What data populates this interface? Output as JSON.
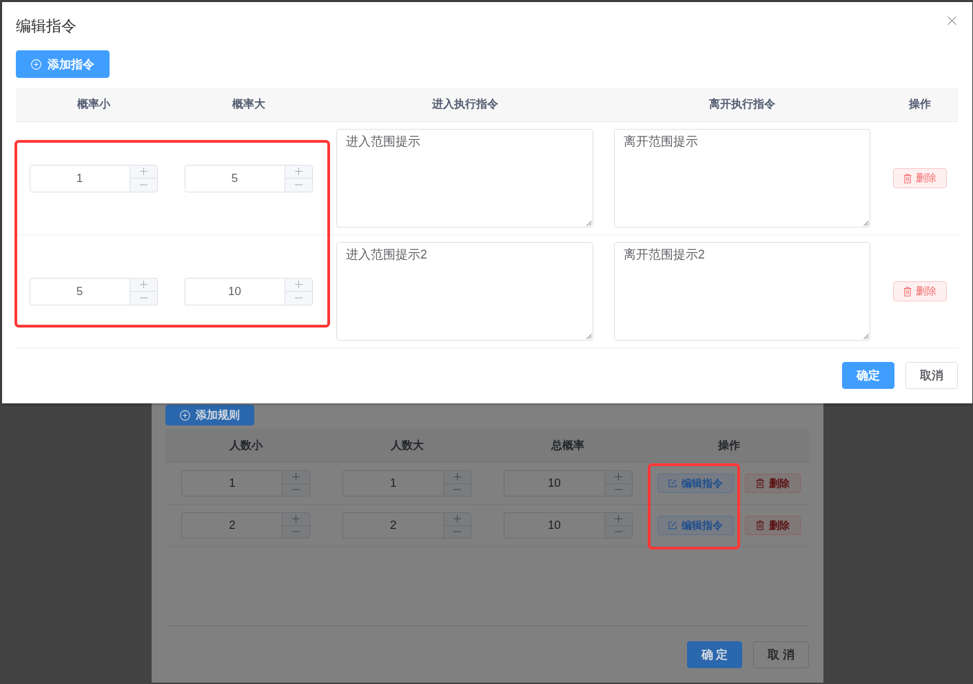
{
  "dialog": {
    "title": "编辑指令",
    "add_button": "添加指令",
    "table": {
      "columns": [
        "概率小",
        "概率大",
        "进入执行指令",
        "离开执行指令",
        "操作"
      ],
      "rows": [
        {
          "min": "1",
          "max": "5",
          "enter_command": "进入范围提示",
          "leave_command": "离开范围提示",
          "delete_button": "删除"
        },
        {
          "min": "5",
          "max": "10",
          "enter_command": "进入范围提示2",
          "leave_command": "离开范围提示2",
          "delete_button": "删除"
        }
      ]
    },
    "buttons": [
      {
        "label": "确定",
        "kind": "primary"
      },
      {
        "label": "取消",
        "kind": "default"
      }
    ]
  },
  "background_dialog": {
    "add_button": "添加规则",
    "table": {
      "columns": [
        "人数小",
        "人数大",
        "总概率",
        "操作"
      ],
      "rows": [
        {
          "min": "1",
          "max": "1",
          "total_probability": "10",
          "edit_button": "编辑指令",
          "delete_button": "删除"
        },
        {
          "min": "2",
          "max": "2",
          "total_probability": "10",
          "edit_button": "编辑指令",
          "delete_button": "删除"
        }
      ]
    },
    "buttons": [
      {
        "label": "确 定",
        "kind": "primary"
      },
      {
        "label": "取 消",
        "kind": "default"
      }
    ]
  }
}
